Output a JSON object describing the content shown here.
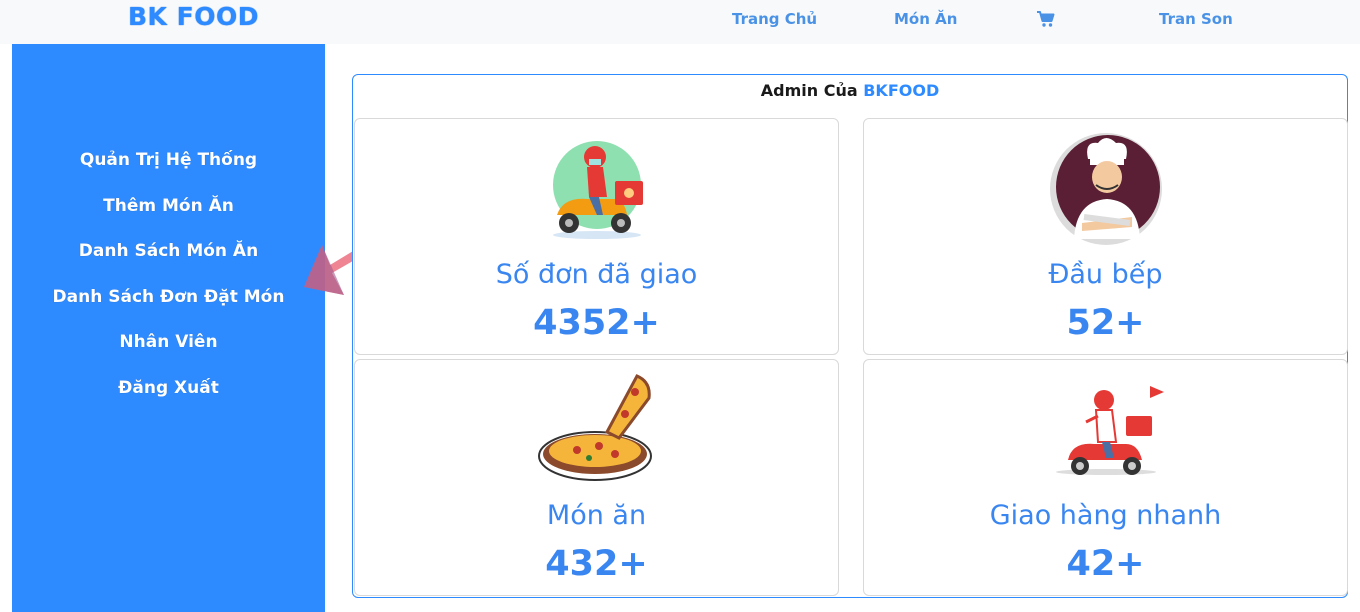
{
  "navbar": {
    "brand": "BK FOOD",
    "links": [
      {
        "label": "Trang Chủ"
      },
      {
        "label": "Món Ăn"
      }
    ],
    "cart_icon": "shopping-cart-icon",
    "user": "Tran Son"
  },
  "sidebar": {
    "items": [
      {
        "label": "Quản Trị Hệ Thống"
      },
      {
        "label": "Thêm Món Ăn"
      },
      {
        "label": "Danh Sách Món Ăn"
      },
      {
        "label": "Danh Sách Đơn Đặt Món"
      },
      {
        "label": "Nhân Viên"
      },
      {
        "label": "Đăng Xuất"
      }
    ]
  },
  "panel": {
    "title_prefix": "Admin Của ",
    "title_accent": "BKFOOD"
  },
  "cards": [
    {
      "label": "Số đơn đã giao",
      "value": "4352+",
      "icon": "delivery-scooter-image"
    },
    {
      "label": "Đầu bếp",
      "value": "52+",
      "icon": "chef-image"
    },
    {
      "label": "Món ăn",
      "value": "432+",
      "icon": "pizza-image"
    },
    {
      "label": "Giao hàng nhanh",
      "value": "42+",
      "icon": "fast-delivery-image"
    }
  ],
  "colors": {
    "brand": "#2e8bff",
    "sidebar": "#2e8bff",
    "card_text": "#3a86f0",
    "arrow": "#ec6f7f"
  }
}
